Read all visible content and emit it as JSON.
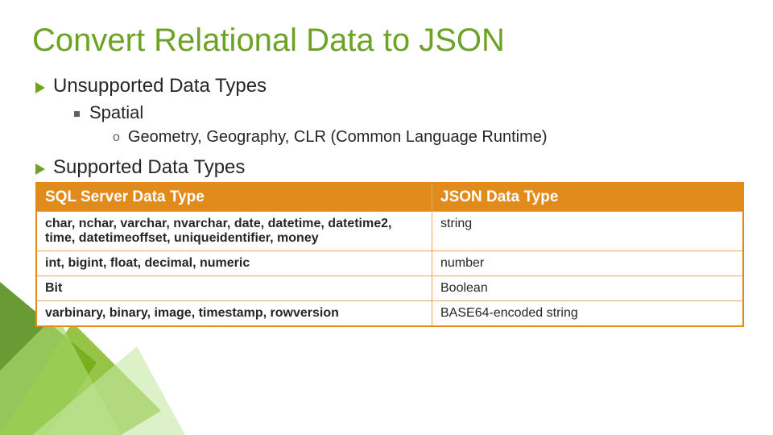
{
  "title": "Convert Relational Data to JSON",
  "bullets": {
    "unsupported": "Unsupported Data Types",
    "spatial": "Spatial",
    "spatial_detail": "Geometry, Geography, CLR (Common Language Runtime)",
    "supported": "Supported Data Types",
    "circle_mark": "o"
  },
  "table": {
    "headers": {
      "sql": "SQL Server Data Type",
      "json": "JSON Data Type"
    },
    "rows": [
      {
        "sql": "char, nchar, varchar, nvarchar, date, datetime, datetime2, time, datetimeoffset, uniqueidentifier, money",
        "json": "string"
      },
      {
        "sql": "int, bigint, float, decimal, numeric",
        "json": "number"
      },
      {
        "sql": "Bit",
        "json": "Boolean"
      },
      {
        "sql": "varbinary, binary, image, timestamp, rowversion",
        "json": "BASE64-encoded string"
      }
    ]
  }
}
